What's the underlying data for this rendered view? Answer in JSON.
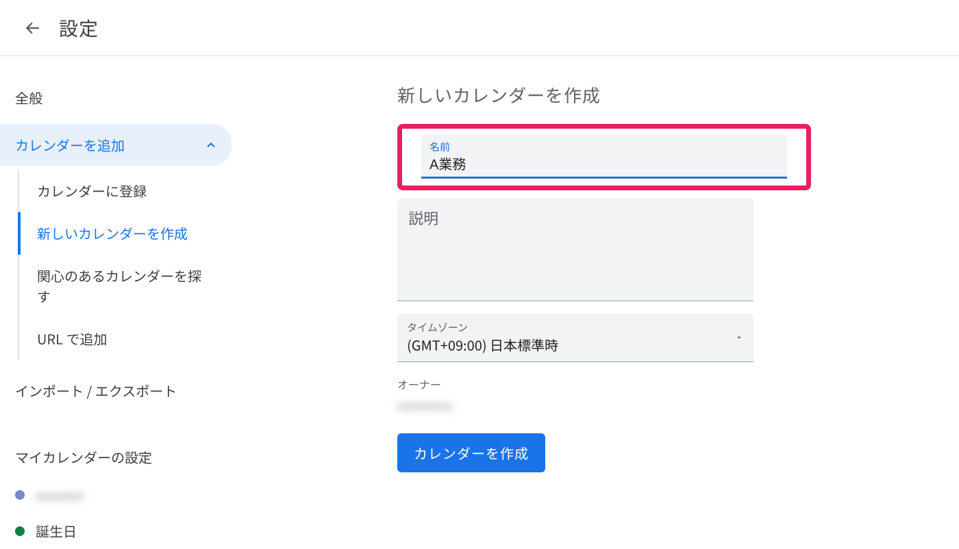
{
  "header": {
    "title": "設定"
  },
  "sidebar": {
    "general": "全般",
    "add_calendar": "カレンダーを追加",
    "sub": {
      "subscribe": "カレンダーに登録",
      "create_new": "新しいカレンダーを作成",
      "browse_interest": "関心のあるカレンダーを探す",
      "add_by_url": "URL で追加"
    },
    "import_export": "インポート / エクスポート",
    "my_calendars_header": "マイカレンダーの設定",
    "my_calendars": [
      {
        "label": "xxxxxxx",
        "color": "#7986cb",
        "redacted": true
      },
      {
        "label": "誕生日",
        "color": "#0b8043",
        "redacted": false
      }
    ]
  },
  "main": {
    "heading": "新しいカレンダーを作成",
    "name_label": "名前",
    "name_value": "A業務",
    "description_label": "説明",
    "timezone_label": "タイムゾーン",
    "timezone_value": "(GMT+09:00) 日本標準時",
    "owner_label": "オーナー",
    "owner_value": "xxxxxxxxx",
    "create_button": "カレンダーを作成"
  },
  "colors": {
    "accent": "#1a73e8",
    "highlight": "#ea1e63"
  }
}
